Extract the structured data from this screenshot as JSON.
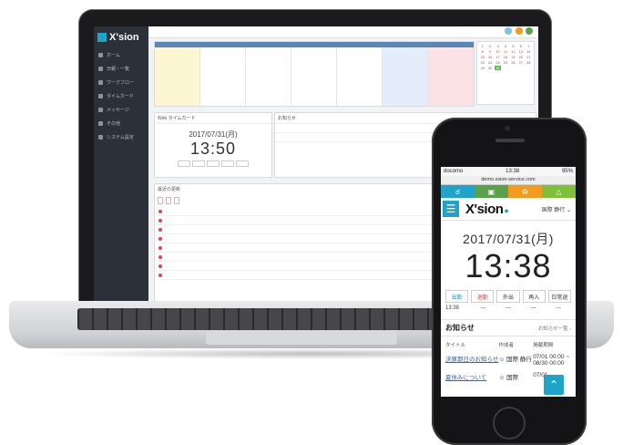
{
  "laptop": {
    "brand": "X'sion",
    "sidebar_items": [
      "ホーム",
      "日報・一覧",
      "ワークフロー",
      "タイムカード",
      "メッセージ",
      "その他",
      "システム設定"
    ],
    "timecard": {
      "title": "Web タイムカード",
      "date": "2017/07/31(月)",
      "time": "13:50"
    },
    "news_title": "お知らせ",
    "list_title": "最近の更新"
  },
  "phone": {
    "status": {
      "carrier": "docomo",
      "time": "13:38",
      "battery": "95%"
    },
    "url": "demo.xsion-service.com",
    "icon_colors": [
      "#1fa3c8",
      "#5aa14c",
      "#f29b1d",
      "#7fbf3a"
    ],
    "brand": "X'sion",
    "user_label": "国際 静行",
    "date": "2017/07/31(月)",
    "time": "13:38",
    "buttons": [
      "出勤",
      "退勤",
      "外出",
      "再入",
      "日常退"
    ],
    "punch_values": [
      "13:38",
      "---",
      "---",
      "---",
      "---"
    ],
    "notice": {
      "title": "お知らせ",
      "more_link": "お知らせ一覧",
      "headers": [
        "タイトル",
        "作成者",
        "掲載期間"
      ],
      "rows": [
        {
          "title": "決算期日のお知らせ",
          "author": "国際 静行",
          "period": "07/01 00:00 ~ 08/30 00:00"
        },
        {
          "title": "夏休みについて",
          "author": "国際",
          "period": "07/01"
        }
      ]
    }
  }
}
